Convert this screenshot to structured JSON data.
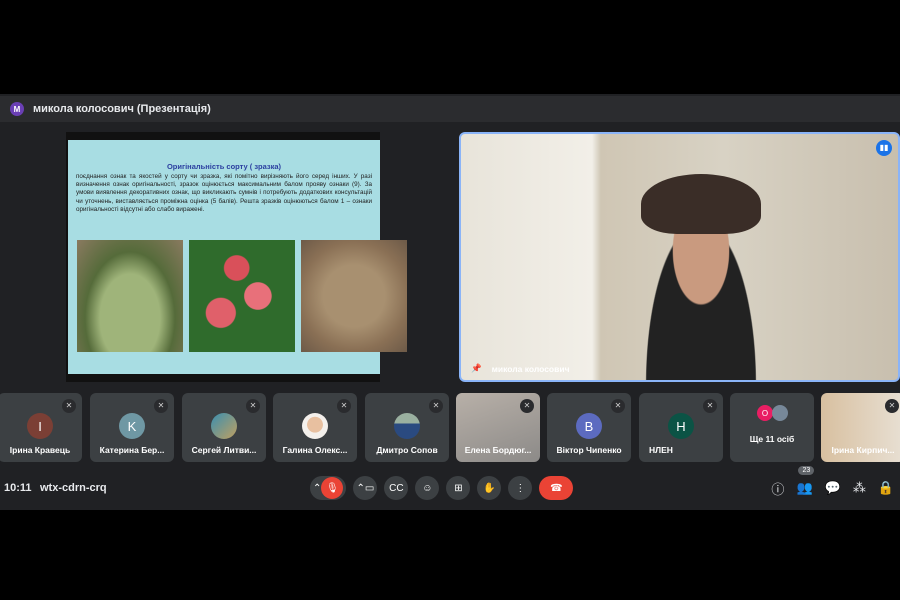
{
  "header": {
    "avatar_letter": "М",
    "title": "микола колосович (Презентація)"
  },
  "slide": {
    "title": "Оригінальність сорту ( зразка)",
    "body": "поєднання ознак та якостей у сорту чи зразка, які помітно вирізняють його серед інших. У разі визначення ознак оригінальності, зразок оцінюється максимальним балом прояву ознаки (9). За умови виявлення декоративних ознак, що викликають сумнів і потребують додаткових консультацій чи уточнень, виставляється проміжна оцінка (5 балів). Решта зразків оцінюються балом 1 – ознаки оригінальності відсутні або слабо виражені."
  },
  "main_video": {
    "name": "микола колосович"
  },
  "participants": [
    {
      "name": "Ірина Кравець",
      "initial": "I",
      "color": "#7b3f35"
    },
    {
      "name": "Катерина Бер...",
      "initial": "K",
      "color": "#6f98a4"
    },
    {
      "name": "Сергей Литви...",
      "initial": "",
      "color": "#5a7d9a"
    },
    {
      "name": "Галина Олекс...",
      "initial": "",
      "color": "#e8d0c0"
    },
    {
      "name": "Дмитро Сопов",
      "initial": "",
      "color": "#4a6a8a"
    },
    {
      "name": "Елена Бордюг...",
      "initial": "",
      "color": ""
    },
    {
      "name": "Віктор Чипенко",
      "initial": "B",
      "color": "#5c6bc0"
    },
    {
      "name": "НЛЕН",
      "initial": "H",
      "color": "#0b5345"
    },
    {
      "name": "Ще 11 осіб",
      "initial": "O",
      "color": "#e91e63"
    },
    {
      "name": "Ірина Кирпич...",
      "initial": "",
      "color": ""
    }
  ],
  "toolbar": {
    "time": "10:11",
    "meeting_code": "wtx-cdrn-crq",
    "participants_count": "23"
  }
}
